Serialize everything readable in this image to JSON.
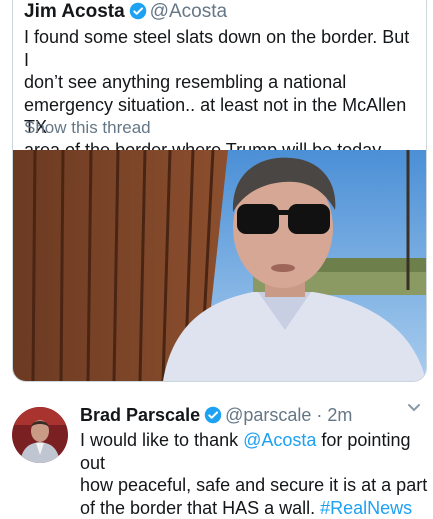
{
  "quoted_tweet": {
    "author_name": "Jim Acosta",
    "author_handle": "@Acosta",
    "verified_icon": "verified-badge-icon",
    "text_lines": [
      "I found some steel slats down on the border. But I",
      "don’t see anything resembling a national",
      "emergency situation.. at least not in the McAllen TX",
      "area of the border where Trump will be today."
    ],
    "show_thread": "Show this thread",
    "media": "video-thumbnail"
  },
  "tweet": {
    "author_name": "Brad Parscale",
    "author_handle": "@parscale",
    "separator": "·",
    "timestamp": "2m",
    "text_parts": {
      "line1": "I would like to thank ",
      "mention": "@Acosta",
      "line1_end": " for pointing out",
      "line2": "how peaceful, safe and secure it is at a part",
      "line3": "of the border that HAS a wall. ",
      "hashtag": "#RealNews"
    },
    "menu_icon": "chevron-down-icon"
  },
  "colors": {
    "link": "#1da1f2",
    "secondary_text": "#657786",
    "border": "#ccd6dd"
  }
}
